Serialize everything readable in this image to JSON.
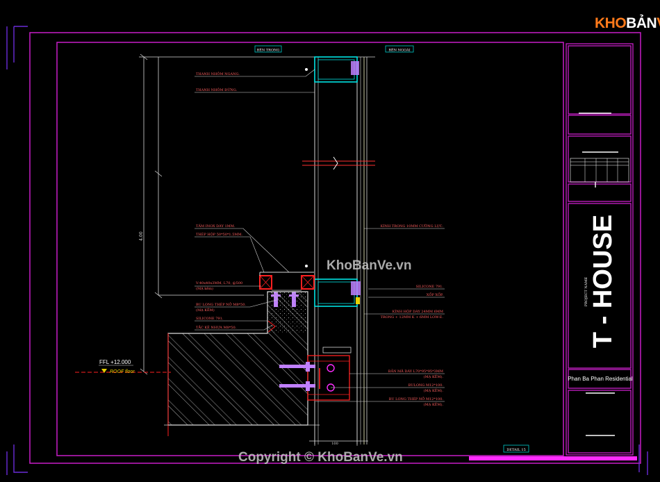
{
  "logo": {
    "part1": "KHO",
    "part2": "BẢN",
    "part3": "VẼ"
  },
  "watermark": {
    "center": "KhoBanVe.vn",
    "footer": "Copyright © KhoBanVe.vn"
  },
  "sections": {
    "inside": "BÊN TRONG",
    "outside": "BÊN NGOÀI"
  },
  "labels": {
    "l1": "THANH NHÔM NGANG.",
    "l2": "THANH NHÔM ĐỨNG.",
    "l3": "TẤM INOX DÀY 1MM.",
    "l4": "THÉP HỘP 50*50*1.5MM.",
    "l5": "V-40x40x3MM, L70, @500",
    "l5b": "(MẠ kẽm)",
    "l6": "BU LONG THÉP NỞ M8*50.",
    "l6b": "(MẠ KẼM)",
    "l7": "SILICONE 791.",
    "l8": "TẮC KÊ NHỰA M8*50.",
    "r1": "KÍNH TRONG 10MM CƯỜNG LỰC.",
    "r2": "SILICONE 791.",
    "r3": "XỐP XỐP.",
    "r4": "KÍNH HỘP DÀY 24MM 6MM",
    "r4b": "TRONG + 12MM K + 6MM LOW-E.",
    "r5": "BẢN MÃ DÀY L70*95*95*3MM",
    "r5b": "(MẠ KẼM).",
    "r6": "BULONG M12*100.",
    "r6b": "(MẠ KẼM).",
    "r7": "BU LONG THÉP NỞ M12*100.",
    "r7b": "(MẠ KẼM)."
  },
  "level": {
    "ffl": "FFL +12.000",
    "name": "ROOF floor"
  },
  "dims": {
    "left_total": "4.00",
    "d_bottom": "100",
    "d_bottom2": "100"
  },
  "detail": "DETAIL 15",
  "title_block": {
    "project_label": "PROJECT NAME",
    "project_name": "T - HOUSE",
    "client": "Phan Ba Phan Residential"
  },
  "colors": {
    "frame": "#c81ec8",
    "glass": "#00e5e5",
    "steel": "#ff2020",
    "line": "#d8d8d8",
    "bolt": "#c080ff"
  }
}
